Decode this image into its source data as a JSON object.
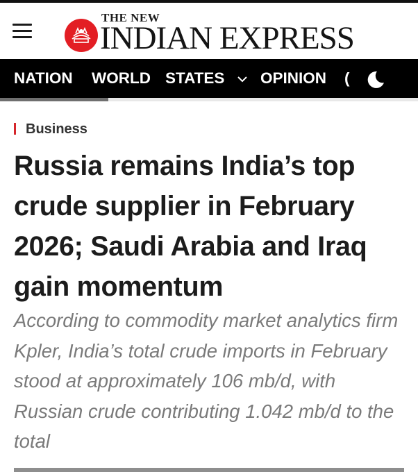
{
  "header": {
    "logo_line1": "THE NEW",
    "logo_line2": "INDIAN EXPRESS",
    "brand_color": "#e31e24",
    "menu_icon": "hamburger-menu-icon"
  },
  "nav": {
    "items": [
      {
        "label": "NATION"
      },
      {
        "label": "WORLD"
      },
      {
        "label": "STATES"
      },
      {
        "label": "OPINION"
      }
    ],
    "overflow_glyph": "(",
    "theme_icon": "moon-icon",
    "background": "#000000"
  },
  "article": {
    "section": "Business",
    "section_color": "#d5262b",
    "headline": "Russia remains India’s top crude supplier in February 2026; Saudi Arabia and Iraq gain momentum",
    "summary": "According to commodity market analytics firm Kpler, India’s total crude imports in February stood at approximately 106 mb/d, with Russian crude contributing 1.042 mb/d to the total"
  }
}
